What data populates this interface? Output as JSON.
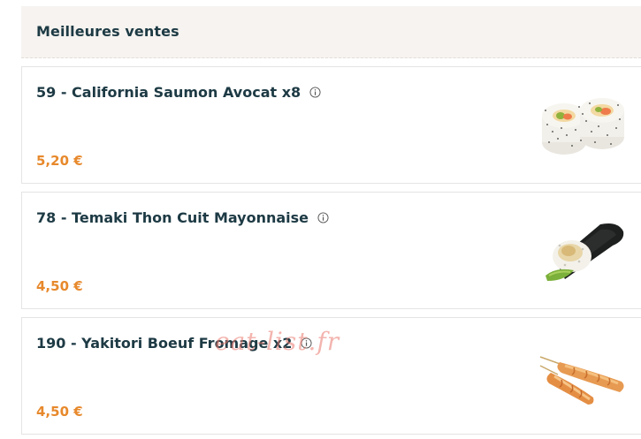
{
  "section": {
    "title": "Meilleures ventes"
  },
  "products": [
    {
      "name": "59 - California Saumon Avocat x8",
      "price": "5,20 €",
      "image": "california-roll-image"
    },
    {
      "name": "78 - Temaki Thon Cuit Mayonnaise",
      "price": "4,50 €",
      "image": "temaki-image"
    },
    {
      "name": "190 - Yakitori Boeuf Fromage x2",
      "price": "4,50 €",
      "image": "yakitori-image"
    }
  ],
  "icons": {
    "info": "info-circle-icon"
  },
  "watermark": "eat-list.fr",
  "colors": {
    "title": "#1d3a44",
    "price": "#e7892c",
    "header_bg": "#f6f3f0"
  }
}
